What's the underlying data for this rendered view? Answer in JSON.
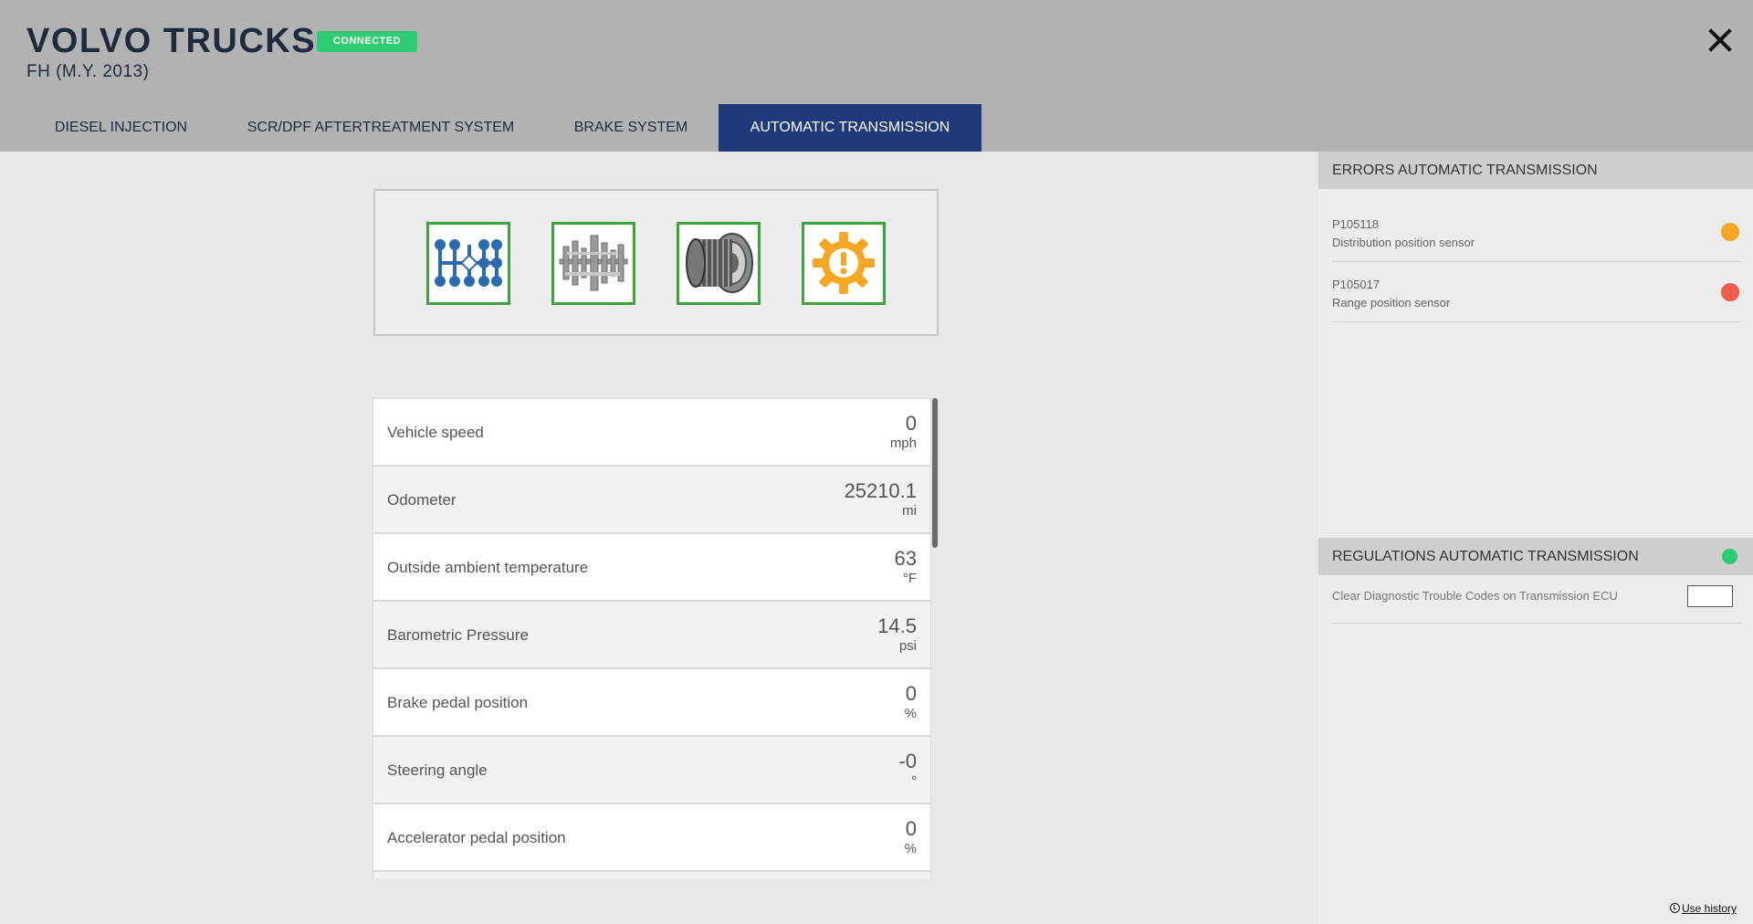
{
  "header": {
    "brand": "VOLVO TRUCKS",
    "model": "FH (M.Y. 2013)",
    "status": "CONNECTED",
    "status_color": "#2ecc71"
  },
  "tabs": [
    {
      "label": "DIESEL INJECTION"
    },
    {
      "label": "SCR/DPF AFTERTREATMENT SYSTEM"
    },
    {
      "label": "BRAKE SYSTEM"
    },
    {
      "label": "AUTOMATIC TRANSMISSION",
      "active": true
    }
  ],
  "icons": [
    "gear-shift-pattern-icon",
    "gearbox-internals-icon",
    "clutch-drum-icon",
    "warning-gear-icon"
  ],
  "parameters": [
    {
      "label": "Vehicle speed",
      "value": "0",
      "unit": "mph"
    },
    {
      "label": "Odometer",
      "value": "25210.1",
      "unit": "mi"
    },
    {
      "label": "Outside ambient temperature",
      "value": "63",
      "unit": "°F"
    },
    {
      "label": "Barometric Pressure",
      "value": "14.5",
      "unit": "psi"
    },
    {
      "label": "Brake pedal position",
      "value": "0",
      "unit": "%"
    },
    {
      "label": "Steering angle",
      "value": "-0",
      "unit": "°"
    },
    {
      "label": "Accelerator pedal position",
      "value": "0",
      "unit": "%"
    }
  ],
  "errors": {
    "title": "ERRORS AUTOMATIC TRANSMISSION",
    "items": [
      {
        "code": "P105118",
        "description": "Distribution position sensor",
        "color": "#f5a623"
      },
      {
        "code": "P105017",
        "description": "Range position sensor",
        "color": "#f05a4f"
      }
    ]
  },
  "regulations": {
    "title": "REGULATIONS AUTOMATIC TRANSMISSION",
    "status_color": "#2ecc71",
    "items": [
      {
        "label": "Clear Diagnostic Trouble Codes on Transmission ECU"
      }
    ]
  },
  "footer": {
    "history_label": "Use history"
  }
}
